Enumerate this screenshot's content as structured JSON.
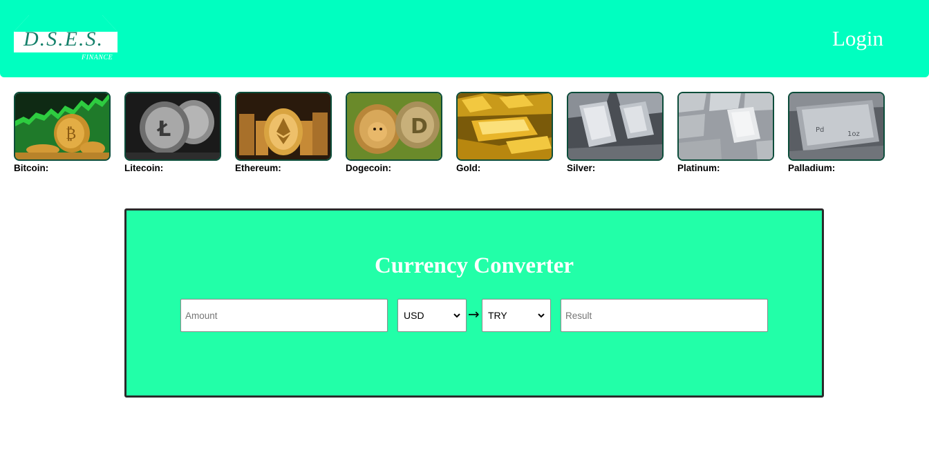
{
  "header": {
    "logo_text": "D.S.E.S.",
    "logo_subtext": "FINANCE",
    "login_label": "Login",
    "background_color": "#00ffc0"
  },
  "assets": [
    {
      "label": "Bitcoin:",
      "image": "bitcoin-coins-image"
    },
    {
      "label": "Litecoin:",
      "image": "litecoin-coins-image"
    },
    {
      "label": "Ethereum:",
      "image": "ethereum-coins-image"
    },
    {
      "label": "Dogecoin:",
      "image": "dogecoin-coins-image"
    },
    {
      "label": "Gold:",
      "image": "gold-bars-image"
    },
    {
      "label": "Silver:",
      "image": "silver-bars-image"
    },
    {
      "label": "Platinum:",
      "image": "platinum-bars-image"
    },
    {
      "label": "Palladium:",
      "image": "palladium-bar-image"
    }
  ],
  "converter": {
    "title": "Currency Converter",
    "amount_placeholder": "Amount",
    "from_currency": "USD",
    "to_currency": "TRY",
    "result_placeholder": "Result",
    "arrow_icon": "right-arrow-icon",
    "background_color": "#22ffa8"
  }
}
